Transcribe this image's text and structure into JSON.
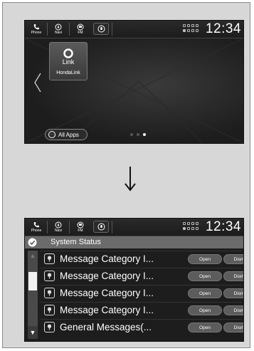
{
  "top_screen": {
    "statusbar": {
      "phone_label": "Phone",
      "navi_label": "Navi",
      "fm_label": "FM",
      "clock": "12:34"
    },
    "app": {
      "name": "HondaLink",
      "logo_text": "Link"
    },
    "all_apps_label": "All Apps",
    "page_dots": {
      "count": 3,
      "active_index": 2
    }
  },
  "bottom_screen": {
    "statusbar": {
      "phone_label": "Phone",
      "navi_label": "Navi",
      "fm_label": "FM",
      "clock": "12:34"
    },
    "header_title": "System Status",
    "messages": [
      {
        "text": "Message Category I...",
        "open": "Open",
        "dismiss": "Dismiss"
      },
      {
        "text": "Message Category I...",
        "open": "Open",
        "dismiss": "Dismiss"
      },
      {
        "text": "Message Category I...",
        "open": "Open",
        "dismiss": "Dismiss"
      },
      {
        "text": "Message Category I...",
        "open": "Open",
        "dismiss": "Dismiss"
      },
      {
        "text": "General Messages(...",
        "open": "Open",
        "dismiss": "Dismiss"
      }
    ]
  },
  "icons": [
    "phone-icon",
    "navi-icon",
    "fm-icon",
    "siri-icon",
    "system-status-icons",
    "chevron-left-icon",
    "down-arrow-icon",
    "check-icon",
    "message-icon"
  ]
}
